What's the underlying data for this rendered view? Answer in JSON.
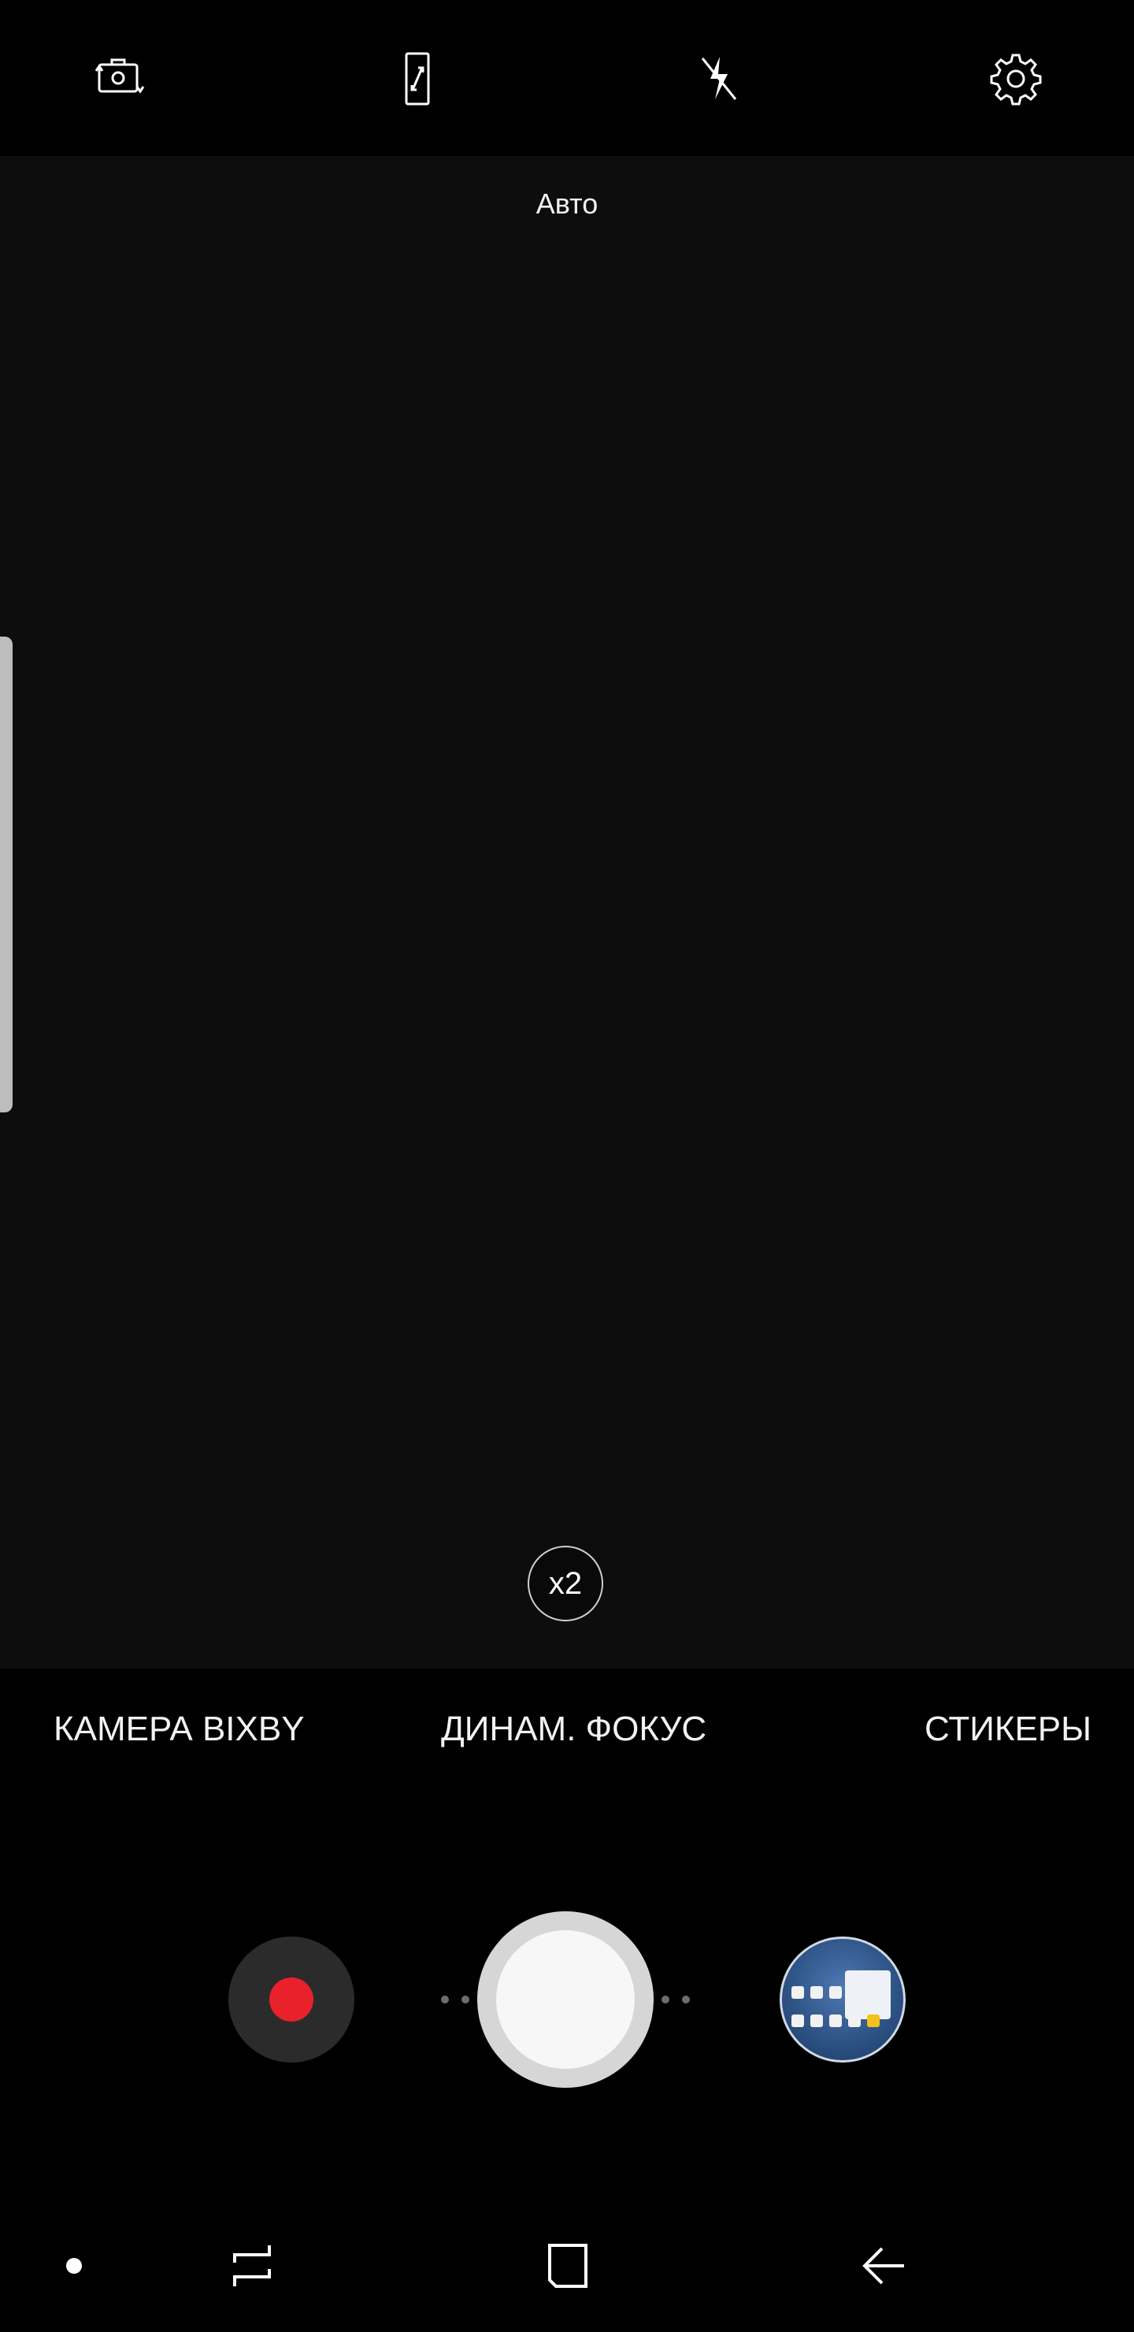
{
  "top_bar": {
    "icons": [
      "switch-camera-icon",
      "aspect-ratio-icon",
      "flash-off-icon",
      "settings-icon"
    ]
  },
  "viewfinder": {
    "mode_label": "Авто",
    "zoom_label": "x2"
  },
  "modes": [
    {
      "label": "КАМЕРА BIXBY"
    },
    {
      "label": "ДИНАМ. ФОКУС"
    },
    {
      "label": "СТИКЕРЫ"
    }
  ],
  "controls": {
    "record_color": "#e8212b",
    "shutter_color": "#f7f7f7"
  },
  "nav_bar": {
    "icons": [
      "nav-dot-icon",
      "recents-icon",
      "home-icon",
      "back-icon"
    ]
  }
}
